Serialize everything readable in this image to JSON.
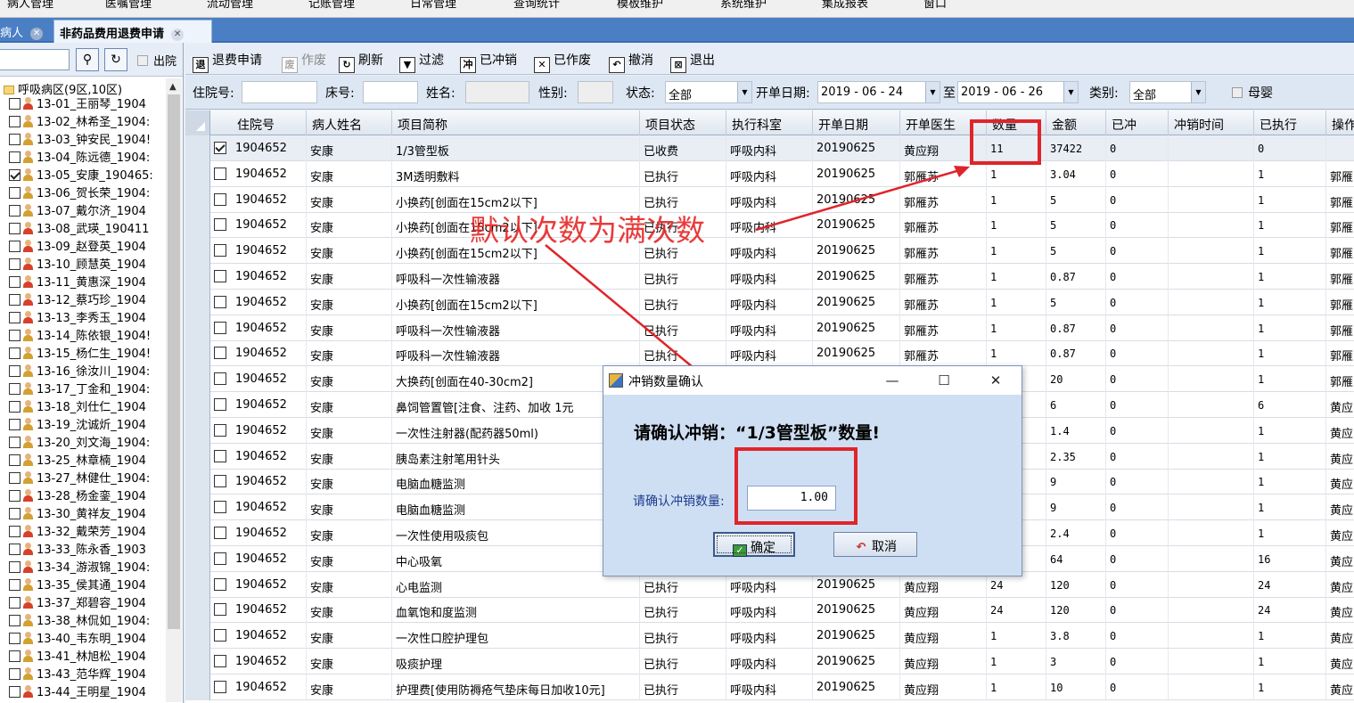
{
  "menu": [
    "病人管理",
    "医嘱管理",
    "流动管理",
    "记账管理",
    "日常管理",
    "查询统计",
    "模板维护",
    "系统维护",
    "集成报表",
    "窗口"
  ],
  "tabs": [
    {
      "label": "病人"
    },
    {
      "label": "非药品费用退费申请"
    }
  ],
  "left": {
    "out_label": "出院",
    "root_label": "呼吸病区(9区,10区)",
    "patients": [
      {
        "label": "13-01_王丽琴_1904",
        "checked": false,
        "gender": "f"
      },
      {
        "label": "13-02_林希圣_1904:",
        "checked": false,
        "gender": "m"
      },
      {
        "label": "13-03_钟安民_1904!",
        "checked": false,
        "gender": "m"
      },
      {
        "label": "13-04_陈远德_1904:",
        "checked": false,
        "gender": "m"
      },
      {
        "label": "13-05_安康_190465:",
        "checked": true,
        "gender": "m"
      },
      {
        "label": "13-06_贺长荣_1904:",
        "checked": false,
        "gender": "m"
      },
      {
        "label": "13-07_戴尔济_1904",
        "checked": false,
        "gender": "m"
      },
      {
        "label": "13-08_武瑛_190411",
        "checked": false,
        "gender": "f"
      },
      {
        "label": "13-09_赵登英_1904",
        "checked": false,
        "gender": "f"
      },
      {
        "label": "13-10_顾慧英_1904",
        "checked": false,
        "gender": "f"
      },
      {
        "label": "13-11_黄惠深_1904",
        "checked": false,
        "gender": "f"
      },
      {
        "label": "13-12_蔡巧珍_1904",
        "checked": false,
        "gender": "f"
      },
      {
        "label": "13-13_李秀玉_1904",
        "checked": false,
        "gender": "f"
      },
      {
        "label": "13-14_陈依银_1904!",
        "checked": false,
        "gender": "m"
      },
      {
        "label": "13-15_杨仁生_1904!",
        "checked": false,
        "gender": "m"
      },
      {
        "label": "13-16_徐汝川_1904:",
        "checked": false,
        "gender": "m"
      },
      {
        "label": "13-17_丁金和_1904:",
        "checked": false,
        "gender": "m"
      },
      {
        "label": "13-18_刘仕仁_1904",
        "checked": false,
        "gender": "m"
      },
      {
        "label": "13-19_沈诚炘_1904",
        "checked": false,
        "gender": "m"
      },
      {
        "label": "13-20_刘文海_1904:",
        "checked": false,
        "gender": "m"
      },
      {
        "label": "13-25_林章楠_1904",
        "checked": false,
        "gender": "m"
      },
      {
        "label": "13-27_林健仕_1904:",
        "checked": false,
        "gender": "m"
      },
      {
        "label": "13-28_杨金銮_1904",
        "checked": false,
        "gender": "f"
      },
      {
        "label": "13-30_黄祥友_1904",
        "checked": false,
        "gender": "m"
      },
      {
        "label": "13-32_戴荣芳_1904",
        "checked": false,
        "gender": "f"
      },
      {
        "label": "13-33_陈永香_1903",
        "checked": false,
        "gender": "f"
      },
      {
        "label": "13-34_游淑锦_1904:",
        "checked": false,
        "gender": "f"
      },
      {
        "label": "13-35_侯其通_1904",
        "checked": false,
        "gender": "m"
      },
      {
        "label": "13-37_郑碧容_1904",
        "checked": false,
        "gender": "f"
      },
      {
        "label": "13-38_林侃如_1904:",
        "checked": false,
        "gender": "m"
      },
      {
        "label": "13-40_韦东明_1904",
        "checked": false,
        "gender": "m"
      },
      {
        "label": "13-41_林旭松_1904",
        "checked": false,
        "gender": "m"
      },
      {
        "label": "13-43_范华辉_1904",
        "checked": false,
        "gender": "m"
      },
      {
        "label": "13-44_王明星_1904",
        "checked": false,
        "gender": "f"
      }
    ]
  },
  "toolbar": [
    {
      "label": "退费申请",
      "icon": "refund-icon",
      "glyph": "退",
      "disabled": false
    },
    {
      "label": "作废",
      "icon": "trash-icon",
      "glyph": "废",
      "disabled": true
    },
    {
      "label": "刷新",
      "icon": "refresh-icon",
      "glyph": "↻",
      "disabled": false
    },
    {
      "label": "过滤",
      "icon": "filter-icon",
      "glyph": "▼",
      "disabled": false
    },
    {
      "label": "已冲销",
      "icon": "offset-icon",
      "glyph": "冲",
      "disabled": false
    },
    {
      "label": "已作废",
      "icon": "voided-icon",
      "glyph": "✕",
      "disabled": false
    },
    {
      "label": "撤消",
      "icon": "undo-icon",
      "glyph": "↶",
      "disabled": false
    },
    {
      "label": "退出",
      "icon": "exit-icon",
      "glyph": "⊠",
      "disabled": false
    }
  ],
  "filter": {
    "inpatient_no_label": "住院号:",
    "bed_no_label": "床号:",
    "name_label": "姓名:",
    "gender_label": "性别:",
    "status_label": "状态:",
    "status_value": "全部",
    "start_date_label": "开单日期:",
    "start_date": "2019 - 06 - 24",
    "to_label": "至",
    "end_date": "2019 - 06 - 26",
    "category_label": "类别:",
    "category_value": "全部",
    "infant_label": "母婴"
  },
  "table": {
    "columns": [
      "住院号",
      "病人姓名",
      "项目简称",
      "项目状态",
      "执行科室",
      "开单日期",
      "开单医生",
      "数量",
      "金额",
      "已冲",
      "冲销时间",
      "已执行",
      "操作"
    ],
    "rows": [
      {
        "checked": true,
        "selected": true,
        "cells": [
          "1904652",
          "安康",
          "1/3管型板",
          "已收费",
          "呼吸内科",
          "20190625",
          "黄应翔",
          "11",
          "37422",
          "0",
          "",
          "0",
          ""
        ]
      },
      {
        "checked": false,
        "selected": false,
        "cells": [
          "1904652",
          "安康",
          "3M透明敷料",
          "已执行",
          "呼吸内科",
          "20190625",
          "郭雁苏",
          "1",
          "3.04",
          "0",
          "",
          "1",
          "郭雁"
        ]
      },
      {
        "checked": false,
        "selected": false,
        "cells": [
          "1904652",
          "安康",
          "小换药[创面在15cm2以下]",
          "已执行",
          "呼吸内科",
          "20190625",
          "郭雁苏",
          "1",
          "5",
          "0",
          "",
          "1",
          "郭雁"
        ]
      },
      {
        "checked": false,
        "selected": false,
        "cells": [
          "1904652",
          "安康",
          "小换药[创面在15cm2以下]",
          "已执行",
          "呼吸内科",
          "20190625",
          "郭雁苏",
          "1",
          "5",
          "0",
          "",
          "1",
          "郭雁"
        ]
      },
      {
        "checked": false,
        "selected": false,
        "cells": [
          "1904652",
          "安康",
          "小换药[创面在15cm2以下]",
          "已执行",
          "呼吸内科",
          "20190625",
          "郭雁苏",
          "1",
          "5",
          "0",
          "",
          "1",
          "郭雁"
        ]
      },
      {
        "checked": false,
        "selected": false,
        "cells": [
          "1904652",
          "安康",
          "呼吸科一次性输液器",
          "已执行",
          "呼吸内科",
          "20190625",
          "郭雁苏",
          "1",
          "0.87",
          "0",
          "",
          "1",
          "郭雁"
        ]
      },
      {
        "checked": false,
        "selected": false,
        "cells": [
          "1904652",
          "安康",
          "小换药[创面在15cm2以下]",
          "已执行",
          "呼吸内科",
          "20190625",
          "郭雁苏",
          "1",
          "5",
          "0",
          "",
          "1",
          "郭雁"
        ]
      },
      {
        "checked": false,
        "selected": false,
        "cells": [
          "1904652",
          "安康",
          "呼吸科一次性输液器",
          "已执行",
          "呼吸内科",
          "20190625",
          "郭雁苏",
          "1",
          "0.87",
          "0",
          "",
          "1",
          "郭雁"
        ]
      },
      {
        "checked": false,
        "selected": false,
        "cells": [
          "1904652",
          "安康",
          "呼吸科一次性输液器",
          "已执行",
          "呼吸内科",
          "20190625",
          "郭雁苏",
          "1",
          "0.87",
          "0",
          "",
          "1",
          "郭雁"
        ]
      },
      {
        "checked": false,
        "selected": false,
        "cells": [
          "1904652",
          "安康",
          "大换药[创面在40-30cm2]",
          "",
          "",
          "",
          "",
          "",
          "20",
          "0",
          "",
          "1",
          "郭雁"
        ]
      },
      {
        "checked": false,
        "selected": false,
        "cells": [
          "1904652",
          "安康",
          "鼻饲管置管[注食、注药、加收 1元",
          "",
          "",
          "",
          "",
          "",
          "6",
          "0",
          "",
          "6",
          "黄应"
        ]
      },
      {
        "checked": false,
        "selected": false,
        "cells": [
          "1904652",
          "安康",
          "一次性注射器(配药器50ml)",
          "",
          "",
          "",
          "",
          "",
          "1.4",
          "0",
          "",
          "1",
          "黄应"
        ]
      },
      {
        "checked": false,
        "selected": false,
        "cells": [
          "1904652",
          "安康",
          "胰岛素注射笔用针头",
          "",
          "",
          "",
          "",
          "",
          "2.35",
          "0",
          "",
          "1",
          "黄应"
        ]
      },
      {
        "checked": false,
        "selected": false,
        "cells": [
          "1904652",
          "安康",
          "电脑血糖监测",
          "",
          "",
          "",
          "",
          "",
          "9",
          "0",
          "",
          "1",
          "黄应"
        ]
      },
      {
        "checked": false,
        "selected": false,
        "cells": [
          "1904652",
          "安康",
          "电脑血糖监测",
          "",
          "",
          "",
          "",
          "",
          "9",
          "0",
          "",
          "1",
          "黄应"
        ]
      },
      {
        "checked": false,
        "selected": false,
        "cells": [
          "1904652",
          "安康",
          "一次性使用吸痰包",
          "",
          "",
          "",
          "",
          "",
          "2.4",
          "0",
          "",
          "1",
          "黄应"
        ]
      },
      {
        "checked": false,
        "selected": false,
        "cells": [
          "1904652",
          "安康",
          "中心吸氧",
          "",
          "",
          "",
          "",
          "",
          "64",
          "0",
          "",
          "16",
          "黄应"
        ]
      },
      {
        "checked": false,
        "selected": false,
        "cells": [
          "1904652",
          "安康",
          "心电监测",
          "已执行",
          "呼吸内科",
          "20190625",
          "黄应翔",
          "24",
          "120",
          "0",
          "",
          "24",
          "黄应"
        ]
      },
      {
        "checked": false,
        "selected": false,
        "cells": [
          "1904652",
          "安康",
          "血氧饱和度监测",
          "已执行",
          "呼吸内科",
          "20190625",
          "黄应翔",
          "24",
          "120",
          "0",
          "",
          "24",
          "黄应"
        ]
      },
      {
        "checked": false,
        "selected": false,
        "cells": [
          "1904652",
          "安康",
          "一次性口腔护理包",
          "已执行",
          "呼吸内科",
          "20190625",
          "黄应翔",
          "1",
          "3.8",
          "0",
          "",
          "1",
          "黄应"
        ]
      },
      {
        "checked": false,
        "selected": false,
        "cells": [
          "1904652",
          "安康",
          "吸痰护理",
          "已执行",
          "呼吸内科",
          "20190625",
          "黄应翔",
          "1",
          "3",
          "0",
          "",
          "1",
          "黄应"
        ]
      },
      {
        "checked": false,
        "selected": false,
        "cells": [
          "1904652",
          "安康",
          "护理费[使用防褥疮气垫床每日加收10元]",
          "已执行",
          "呼吸内科",
          "20190625",
          "黄应翔",
          "1",
          "10",
          "0",
          "",
          "1",
          "黄应"
        ]
      }
    ]
  },
  "annotation": {
    "text": "默认次数为满次数",
    "color": "#e82a2a"
  },
  "dialog": {
    "title": "冲销数量确认",
    "message": "请确认冲销：“1/3管型板”数量!",
    "qty_label": "请确认冲销数量:",
    "qty_value": "1.00",
    "ok_label": "确定",
    "cancel_label": "取消"
  },
  "colors": {
    "tabbar": "#4a7fc4",
    "highlight": "#e0242b"
  }
}
